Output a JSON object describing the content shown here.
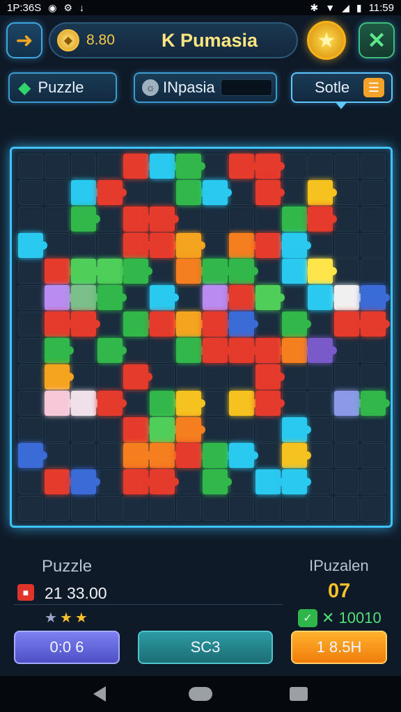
{
  "status_bar": {
    "time_left": "1P:36S",
    "time_right": "11:59"
  },
  "header": {
    "coin_value": "8.80",
    "title": "K Pumasia"
  },
  "tabs": {
    "puzzle_label": "Puzzle",
    "mode_label": "INpasia",
    "sort_label": "Sotle"
  },
  "colors": {
    "accent_cyan": "#3fc3ff",
    "gold": "#f6c02c",
    "green": "#2fd46a",
    "red": "#e0342a"
  },
  "board": {
    "rows": 14,
    "cols": 14,
    "pieces": [
      [
        0,
        4,
        "#e53b2c"
      ],
      [
        0,
        5,
        "#29c9f0"
      ],
      [
        0,
        6,
        "#32b84a"
      ],
      [
        0,
        8,
        "#e53b2c"
      ],
      [
        0,
        9,
        "#e53b2c"
      ],
      [
        1,
        2,
        "#29c9f0"
      ],
      [
        1,
        3,
        "#e53b2c"
      ],
      [
        1,
        6,
        "#32b84a"
      ],
      [
        1,
        7,
        "#29c9f0"
      ],
      [
        1,
        9,
        "#e53b2c"
      ],
      [
        1,
        11,
        "#f5c21f"
      ],
      [
        2,
        2,
        "#32b84a"
      ],
      [
        2,
        4,
        "#e53b2c"
      ],
      [
        2,
        5,
        "#e53b2c"
      ],
      [
        2,
        10,
        "#32b84a"
      ],
      [
        2,
        11,
        "#e53b2c"
      ],
      [
        3,
        0,
        "#29c9f0"
      ],
      [
        3,
        4,
        "#e53b2c"
      ],
      [
        3,
        5,
        "#e53b2c"
      ],
      [
        3,
        6,
        "#f5a41f"
      ],
      [
        3,
        8,
        "#f57e1f"
      ],
      [
        3,
        9,
        "#e53b2c"
      ],
      [
        3,
        10,
        "#29c9f0"
      ],
      [
        4,
        1,
        "#e53b2c"
      ],
      [
        4,
        2,
        "#4fcf5a"
      ],
      [
        4,
        3,
        "#4fcf5a"
      ],
      [
        4,
        4,
        "#32b84a"
      ],
      [
        4,
        6,
        "#f57e1f"
      ],
      [
        4,
        7,
        "#32b84a"
      ],
      [
        4,
        8,
        "#32b84a"
      ],
      [
        4,
        10,
        "#29c9f0"
      ],
      [
        4,
        11,
        "#ffe44a"
      ],
      [
        5,
        1,
        "#b88cf0"
      ],
      [
        5,
        2,
        "#7bbf8a"
      ],
      [
        5,
        3,
        "#32b84a"
      ],
      [
        5,
        5,
        "#29c9f0"
      ],
      [
        5,
        7,
        "#b88cf0"
      ],
      [
        5,
        8,
        "#e53b2c"
      ],
      [
        5,
        9,
        "#4fcf5a"
      ],
      [
        5,
        11,
        "#29c9f0"
      ],
      [
        5,
        12,
        "#f0f0f0"
      ],
      [
        5,
        13,
        "#3b6bd6"
      ],
      [
        6,
        1,
        "#e53b2c"
      ],
      [
        6,
        2,
        "#e53b2c"
      ],
      [
        6,
        4,
        "#32b84a"
      ],
      [
        6,
        5,
        "#e53b2c"
      ],
      [
        6,
        6,
        "#f5a41f"
      ],
      [
        6,
        7,
        "#e53b2c"
      ],
      [
        6,
        8,
        "#3b6bd6"
      ],
      [
        6,
        10,
        "#32b84a"
      ],
      [
        6,
        12,
        "#e53b2c"
      ],
      [
        6,
        13,
        "#e53b2c"
      ],
      [
        7,
        1,
        "#32b84a"
      ],
      [
        7,
        3,
        "#32b84a"
      ],
      [
        7,
        6,
        "#32b84a"
      ],
      [
        7,
        7,
        "#e53b2c"
      ],
      [
        7,
        8,
        "#e53b2c"
      ],
      [
        7,
        9,
        "#e53b2c"
      ],
      [
        7,
        10,
        "#f57e1f"
      ],
      [
        7,
        11,
        "#7a5ac8"
      ],
      [
        8,
        1,
        "#f5a41f"
      ],
      [
        8,
        4,
        "#e53b2c"
      ],
      [
        8,
        9,
        "#e53b2c"
      ],
      [
        9,
        1,
        "#f6c8d8"
      ],
      [
        9,
        2,
        "#f0e0ea"
      ],
      [
        9,
        3,
        "#e53b2c"
      ],
      [
        9,
        5,
        "#32b84a"
      ],
      [
        9,
        6,
        "#f5c21f"
      ],
      [
        9,
        8,
        "#f5c21f"
      ],
      [
        9,
        9,
        "#e53b2c"
      ],
      [
        9,
        12,
        "#8a9ae8"
      ],
      [
        9,
        13,
        "#32b84a"
      ],
      [
        10,
        4,
        "#e53b2c"
      ],
      [
        10,
        5,
        "#4fcf5a"
      ],
      [
        10,
        6,
        "#f57e1f"
      ],
      [
        10,
        10,
        "#29c9f0"
      ],
      [
        11,
        0,
        "#3b6bd6"
      ],
      [
        11,
        4,
        "#f57e1f"
      ],
      [
        11,
        5,
        "#f57e1f"
      ],
      [
        11,
        6,
        "#e53b2c"
      ],
      [
        11,
        7,
        "#32b84a"
      ],
      [
        11,
        8,
        "#29c9f0"
      ],
      [
        11,
        10,
        "#f5c21f"
      ],
      [
        12,
        1,
        "#e53b2c"
      ],
      [
        12,
        2,
        "#3b6bd6"
      ],
      [
        12,
        4,
        "#e53b2c"
      ],
      [
        12,
        5,
        "#e53b2c"
      ],
      [
        12,
        7,
        "#32b84a"
      ],
      [
        12,
        9,
        "#29c9f0"
      ],
      [
        12,
        10,
        "#29c9f0"
      ]
    ]
  },
  "stats": {
    "left_label": "Puzzle",
    "right_label": "IPuzalen",
    "score_value": "21 33.00",
    "level_value": "07",
    "bonus_value": "✕ 10010"
  },
  "buttons": {
    "time_label": "0:0 6",
    "score_label": "SC3",
    "bonus_label": "1 8.5H"
  }
}
